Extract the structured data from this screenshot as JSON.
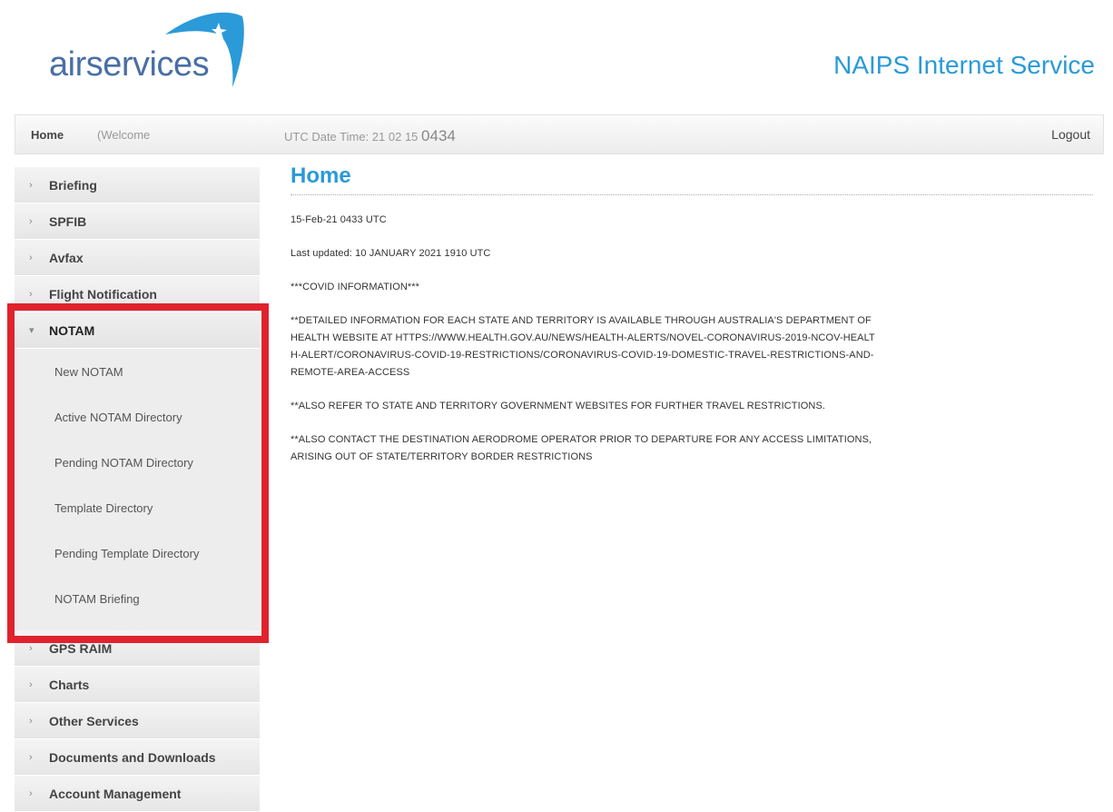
{
  "header": {
    "logo_text": "airservices",
    "app_title": "NAIPS Internet Service"
  },
  "topbar": {
    "home": "Home",
    "welcome": "(Welcome",
    "utc_label": "UTC Date Time: 21 02 15",
    "utc_time": "0434",
    "logout": "Logout"
  },
  "sidebar": {
    "items_before": [
      {
        "label": "Briefing"
      },
      {
        "label": "SPFIB"
      },
      {
        "label": "Avfax"
      },
      {
        "label": "Flight Notification"
      }
    ],
    "open_item": {
      "label": "NOTAM",
      "children": [
        {
          "label": "New NOTAM"
        },
        {
          "label": "Active NOTAM Directory"
        },
        {
          "label": "Pending NOTAM Directory"
        },
        {
          "label": "Template Directory"
        },
        {
          "label": "Pending Template Directory"
        },
        {
          "label": "NOTAM Briefing"
        }
      ]
    },
    "items_after": [
      {
        "label": "GPS RAIM"
      },
      {
        "label": "Charts"
      },
      {
        "label": "Other Services"
      },
      {
        "label": "Documents and Downloads"
      },
      {
        "label": "Account Management"
      }
    ]
  },
  "main": {
    "title": "Home",
    "date": "15-Feb-21 0433 UTC",
    "last_updated": "Last updated: 10 JANUARY 2021 1910 UTC",
    "covid_header": "***COVID INFORMATION***",
    "para1": "**DETAILED INFORMATION FOR EACH STATE AND TERRITORY IS AVAILABLE THROUGH AUSTRALIA'S DEPARTMENT OF HEALTH WEBSITE AT HTTPS://WWW.HEALTH.GOV.AU/NEWS/HEALTH-ALERTS/NOVEL-CORONAVIRUS-2019-NCOV-HEALTH-ALERT/CORONAVIRUS-COVID-19-RESTRICTIONS/CORONAVIRUS-COVID-19-DOMESTIC-TRAVEL-RESTRICTIONS-AND-REMOTE-AREA-ACCESS",
    "para2": "**ALSO REFER TO STATE AND TERRITORY GOVERNMENT WEBSITES FOR FURTHER TRAVEL RESTRICTIONS.",
    "para3": "**ALSO CONTACT THE DESTINATION AERODROME OPERATOR PRIOR TO DEPARTURE FOR ANY ACCESS LIMITATIONS, ARISING OUT OF STATE/TERRITORY BORDER RESTRICTIONS"
  },
  "colors": {
    "brand_blue": "#2a9ad8",
    "logo_text": "#4a6fa5",
    "highlight_red": "#e0232c"
  }
}
